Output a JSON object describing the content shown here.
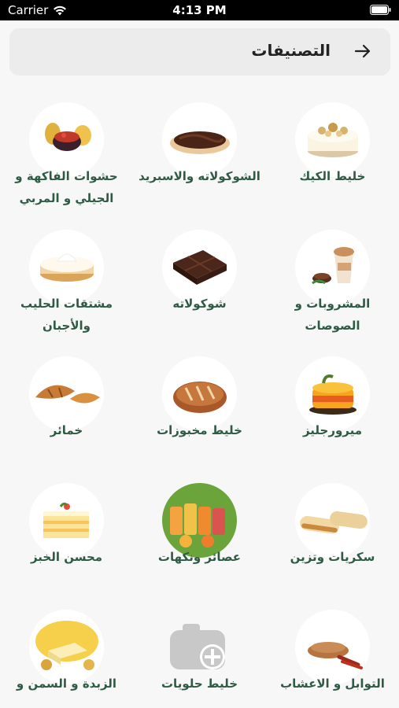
{
  "status_bar": {
    "carrier": "Carrier",
    "time": "4:13 PM"
  },
  "header": {
    "title": "التصنيفات",
    "back_icon": "arrow-right-icon"
  },
  "categories": [
    {
      "label": "خليط الكيك",
      "icon": "cheesecake-icon"
    },
    {
      "label": "الشوكولاته والاسبريد",
      "icon": "chocolate-spread-icon"
    },
    {
      "label": "حشوات الفاكهة و الجيلي و المربي",
      "icon": "fruit-filling-icon"
    },
    {
      "label": "المشروبات و الصوصات",
      "icon": "drinks-icon"
    },
    {
      "label": "شوكولاته",
      "icon": "chocolate-bar-icon"
    },
    {
      "label": "مشتقات الحليب والأجبان",
      "icon": "cream-cheese-icon"
    },
    {
      "label": "ميرورجليز",
      "icon": "mirror-glaze-cake-icon"
    },
    {
      "label": "خليط مخبوزات",
      "icon": "bread-loaf-icon"
    },
    {
      "label": "خمائر",
      "icon": "croissant-icon"
    },
    {
      "label": "سكريات وتزين",
      "icon": "ladyfinger-biscuit-icon"
    },
    {
      "label": "عصائر ونكهات",
      "icon": "juices-icon"
    },
    {
      "label": "محسن الخبز",
      "icon": "layer-cake-icon"
    },
    {
      "label": "التوابل و الاعشاب",
      "icon": "spices-icon"
    },
    {
      "label": "خليط حلويات",
      "icon": "add-photo-placeholder-icon"
    },
    {
      "label": "الزبدة و السمن و الدهون",
      "icon": "butter-icon"
    }
  ]
}
